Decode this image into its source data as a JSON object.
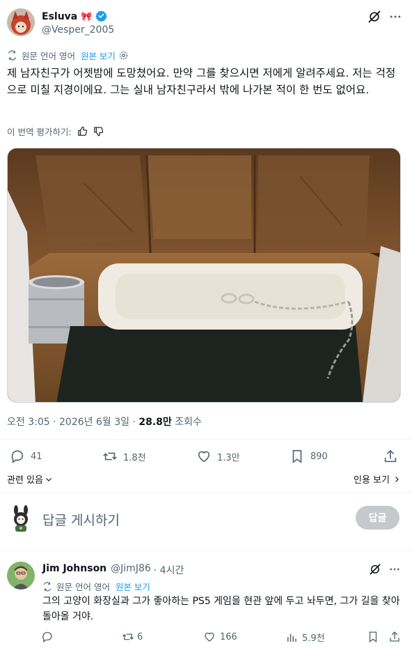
{
  "post": {
    "author_name": "Esluva",
    "author_emoji": "🎀",
    "author_handle": "@Vesper_2005",
    "translate_label": "원문 언어 영어",
    "show_original": "원본 보기",
    "text": "제 남자친구가 어젯밤에 도망쳤어요. 만약 그를 찾으시면 저에게 알려주세요. 저는 걱정으로 미칠 지경이에요. 그는 실내 남자친구라서 밖에 나가본 적이 한 번도 없어요.",
    "rate_translation": "이 번역 평가하기:",
    "time": "오전 3:05 · 2026년 6월 3일 · ",
    "views_count": "28.8만",
    "views_label": " 조회수",
    "replies": "41",
    "reposts": "1.8천",
    "likes": "1.3만",
    "bookmarks": "890",
    "related": "관련 있음",
    "quotes": "인용 보기"
  },
  "compose": {
    "placeholder": "답글 게시하기",
    "button": "답글"
  },
  "reply": {
    "author_name": "Jim Johnson",
    "author_handle": "@JimJ86",
    "time": "· 4시간",
    "translate_label": "원문 언어 영어",
    "show_original": "원본 보기",
    "text": "그의 고양이 화장실과 그가 좋아하는 PS5 게임을 현관 앞에 두고 놔두면, 그가 길을 찾아 돌아올 거야.",
    "replies": "",
    "reposts": "6",
    "likes": "166",
    "views": "5.9천"
  },
  "colors": {
    "accent": "#1d9bf0",
    "muted": "#536471",
    "verified": "#1d9bf0"
  },
  "icons": [
    "grok-icon",
    "more-icon",
    "translate-icon",
    "gear-icon",
    "thumbs-up-icon",
    "thumbs-down-icon",
    "reply-icon",
    "repost-icon",
    "like-icon",
    "bookmark-icon",
    "share-icon",
    "chevron-down-icon",
    "chevron-right-icon",
    "views-icon",
    "verified-badge-icon"
  ]
}
